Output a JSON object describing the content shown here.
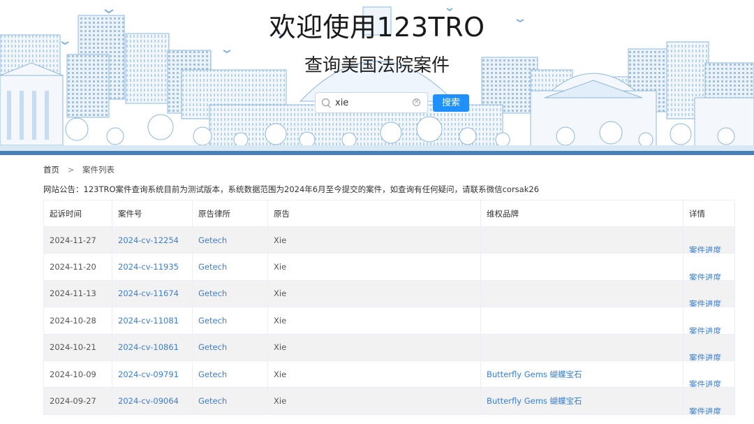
{
  "banner": {
    "title": "欢迎使用123TRO",
    "subtitle": "查询美国法院案件"
  },
  "search": {
    "value": "xie",
    "button_label": "搜索"
  },
  "breadcrumb": {
    "home": "首页",
    "separator": ">",
    "current": "案件列表"
  },
  "notice": "网站公告：123TRO案件查询系统目前为测试版本，系统数据范围为2024年6月至今提交的案件，如查询有任何疑问，请联系微信corsak26",
  "table": {
    "headers": [
      "起诉时间",
      "案件号",
      "原告律所",
      "原告",
      "维权品牌",
      "详情"
    ],
    "rows": [
      {
        "date": "2024-11-27",
        "case_no": "2024-cv-12254",
        "firm": "Getech",
        "plaintiff": "Xie",
        "brand": "",
        "detail": "案件进度"
      },
      {
        "date": "2024-11-20",
        "case_no": "2024-cv-11935",
        "firm": "Getech",
        "plaintiff": "Xie",
        "brand": "",
        "detail": "案件进度"
      },
      {
        "date": "2024-11-13",
        "case_no": "2024-cv-11674",
        "firm": "Getech",
        "plaintiff": "Xie",
        "brand": "",
        "detail": "案件进度"
      },
      {
        "date": "2024-10-28",
        "case_no": "2024-cv-11081",
        "firm": "Getech",
        "plaintiff": "Xie",
        "brand": "",
        "detail": "案件进度"
      },
      {
        "date": "2024-10-21",
        "case_no": "2024-cv-10861",
        "firm": "Getech",
        "plaintiff": "Xie",
        "brand": "",
        "detail": "案件进度"
      },
      {
        "date": "2024-10-09",
        "case_no": "2024-cv-09791",
        "firm": "Getech",
        "plaintiff": "Xie",
        "brand": "Butterfly Gems 蝴蝶宝石",
        "detail": "案件进度"
      },
      {
        "date": "2024-09-27",
        "case_no": "2024-cv-09064",
        "firm": "Getech",
        "plaintiff": "Xie",
        "brand": "Butterfly Gems 蝴蝶宝石",
        "detail": "案件进度"
      }
    ]
  },
  "colors": {
    "link": "#3b7fd6",
    "button": "#1e90ff",
    "skyline": "#8cb8e2",
    "banner_bar": "#4a7fb5"
  }
}
